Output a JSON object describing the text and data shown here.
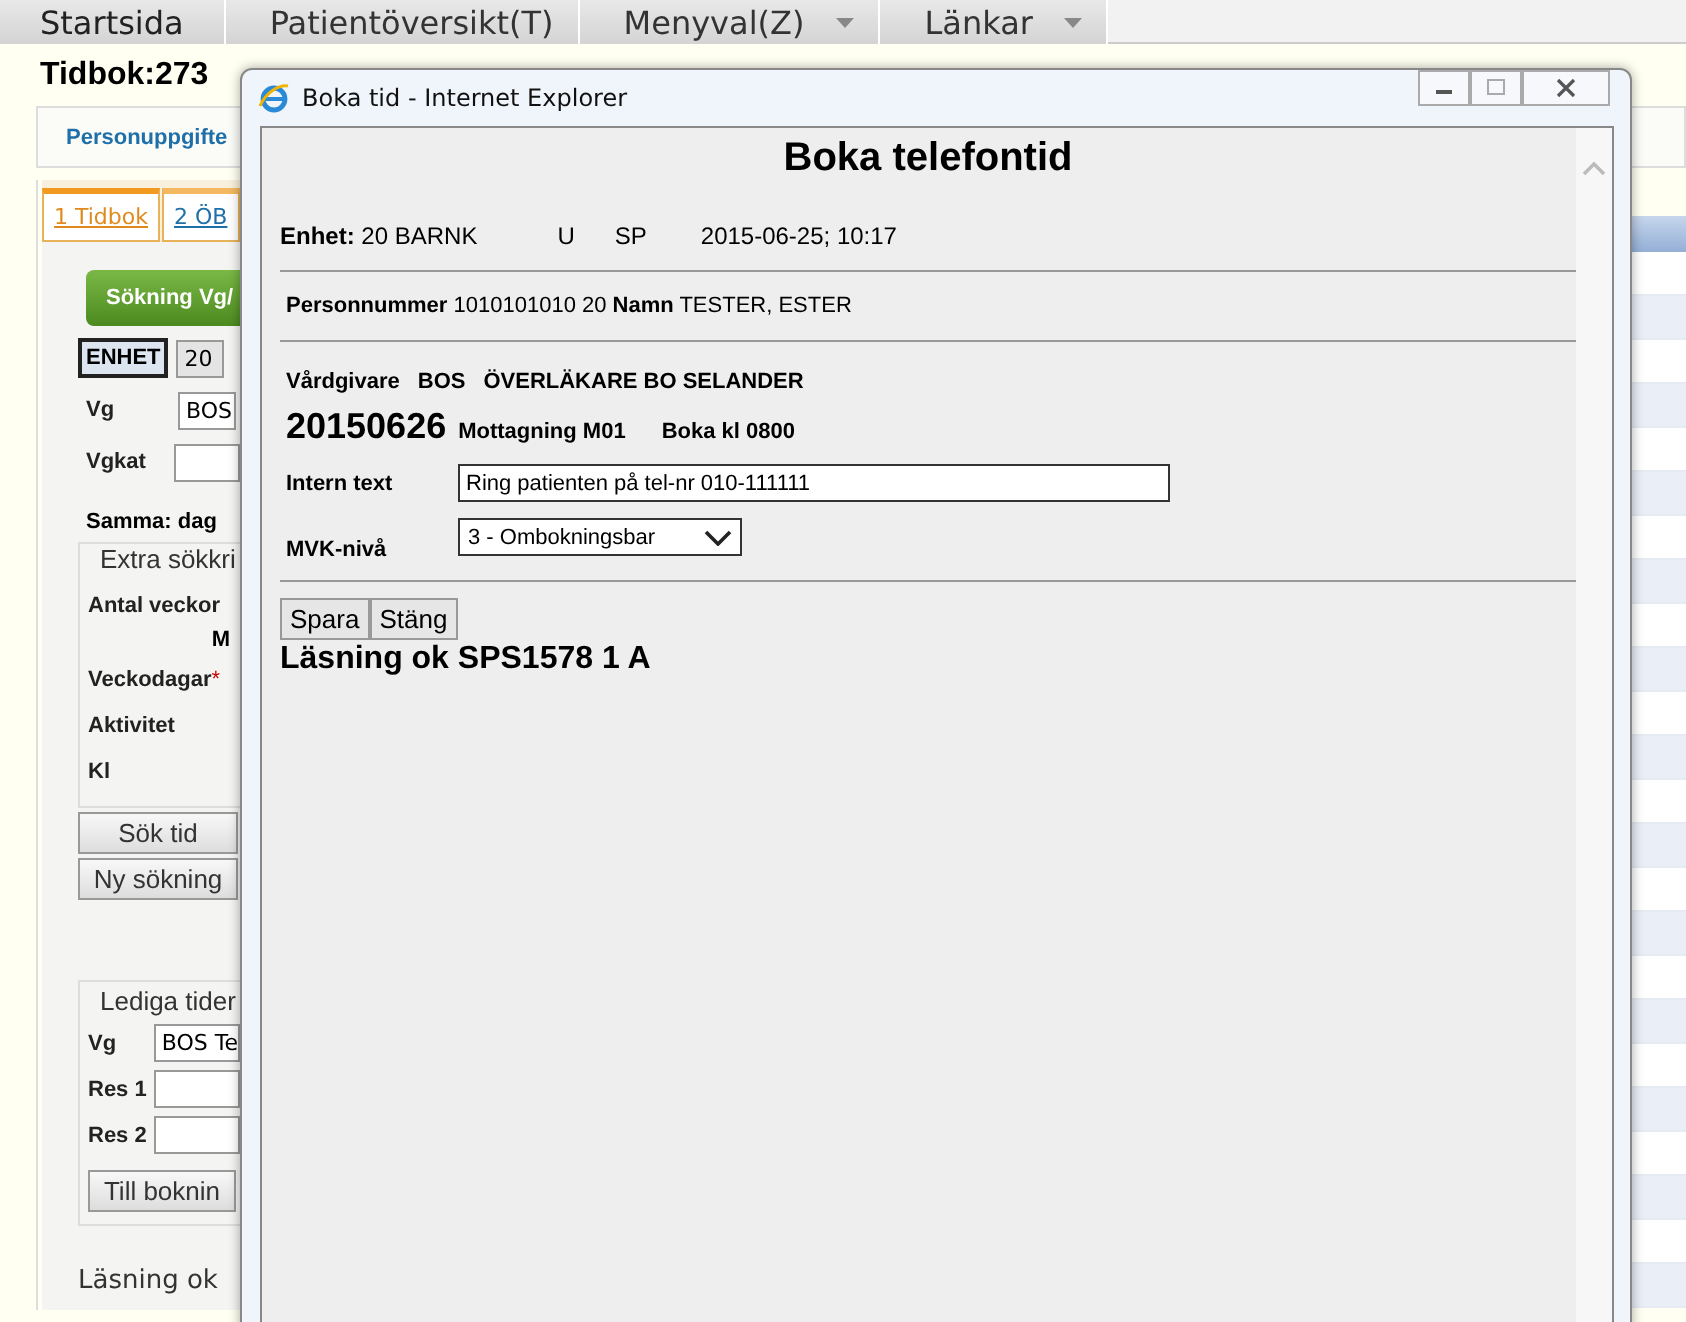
{
  "menu": [
    {
      "label": "Startsida",
      "dropdown": false
    },
    {
      "label": "Patientöversikt(T)",
      "dropdown": false
    },
    {
      "label": "Menyval(Z)",
      "dropdown": true
    },
    {
      "label": "Länkar",
      "dropdown": true
    }
  ],
  "page_title": "Tidbok:273",
  "subnav": {
    "link": "Personuppgifte"
  },
  "tabs": [
    {
      "label": "1 Tidbok",
      "selected": true
    },
    {
      "label": "2 ÖB",
      "selected": false
    }
  ],
  "search": {
    "button": "Sökning Vg/",
    "enhet_label": "ENHET",
    "enhet_value": "20",
    "fields": [
      {
        "label": "Vg",
        "value": "BOS"
      },
      {
        "label": "Vgkat"
      }
    ],
    "same_day": "Samma: dag",
    "extra": {
      "legend": "Extra sökkri",
      "rows": [
        {
          "label": "Antal veckor"
        },
        {
          "label": "Veckodagar",
          "required_mark": "*",
          "note": "M"
        },
        {
          "label": "Aktivitet"
        },
        {
          "label": "Kl"
        }
      ]
    },
    "buttons": [
      "Sök tid",
      "Ny sökning"
    ]
  },
  "free_times": {
    "legend": "Lediga tider",
    "fields": [
      {
        "label": "Vg",
        "value": "BOS Te"
      },
      {
        "label": "Res 1"
      },
      {
        "label": "Res 2"
      }
    ],
    "button": "Till boknin"
  },
  "status": "Läsning ok",
  "popup": {
    "title": "Boka tid - Internet Explorer",
    "heading": "Boka telefontid",
    "unit": {
      "text": "**Enhet:** 20 BARNK",
      "col_3": "U",
      "col_4": "SP",
      "datetime": "2015-06-25; 10:17"
    },
    "patient": "**Personnummer** 1010101010 20 **Namn** TESTER, ESTER",
    "caregiver": {
      "label": "Vårdgivare",
      "code": "BOS",
      "name": "ÖVERLÄKARE BO SELANDER"
    },
    "date": "20150626",
    "reception": "Mottagning M01",
    "time": "Boka kl 0800",
    "intern_text": {
      "label": "Intern text",
      "value": "Ring patienten på tel-nr 010-111111"
    },
    "mvk": {
      "label": "MVK-nivå",
      "value": "3 - Ombokningsbar"
    },
    "buttons": [
      "Spara",
      "Stäng"
    ],
    "message": "Läsning ok SPS1578 1 A"
  }
}
